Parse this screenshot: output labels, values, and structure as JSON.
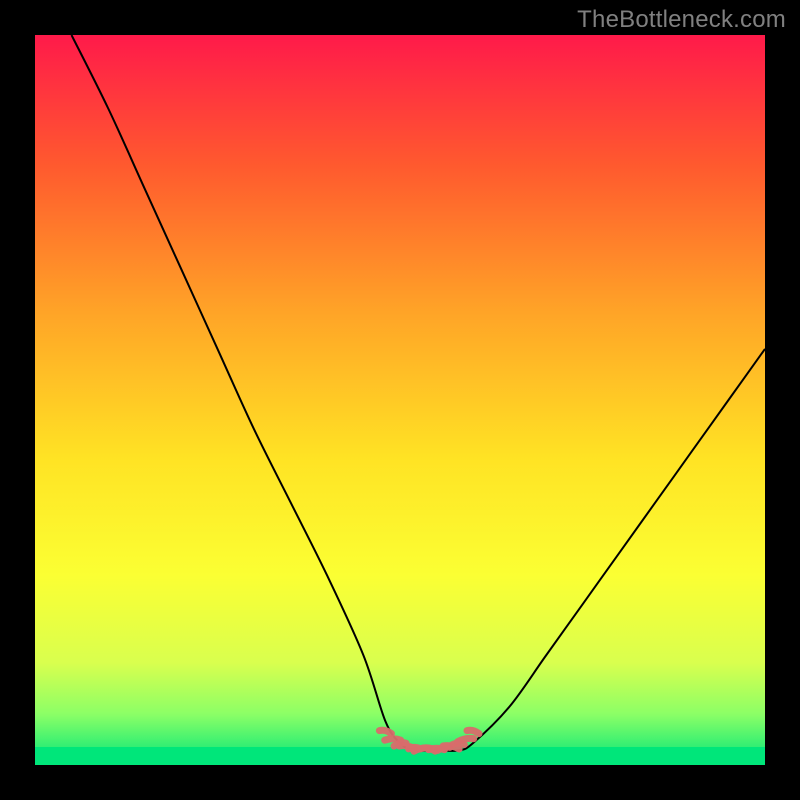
{
  "watermark": "TheBottleneck.com",
  "colors": {
    "frame": "#000000",
    "curve": "#000000",
    "marker": "#d86b6b",
    "gradient": [
      "#ff1a4a",
      "#ff5a2e",
      "#ffa427",
      "#ffe324",
      "#fbff33",
      "#d9ff4e",
      "#8cff66",
      "#00e67a"
    ],
    "bottom_band": "#00e67a"
  },
  "chart_data": {
    "type": "line",
    "title": "",
    "xlabel": "",
    "ylabel": "",
    "xlim": [
      0,
      100
    ],
    "ylim": [
      0,
      100
    ],
    "series": [
      {
        "name": "bottleneck-curve",
        "x": [
          5,
          10,
          15,
          20,
          25,
          30,
          35,
          40,
          45,
          48,
          50,
          52,
          55,
          58,
          60,
          65,
          70,
          75,
          80,
          85,
          90,
          95,
          100
        ],
        "y": [
          100,
          90,
          79,
          68,
          57,
          46,
          36,
          26,
          15,
          6,
          3,
          2,
          2,
          2,
          3,
          8,
          15,
          22,
          29,
          36,
          43,
          50,
          57
        ]
      }
    ],
    "markers": {
      "name": "target-band",
      "x": [
        48,
        49,
        50,
        51,
        52,
        53,
        54,
        55,
        56,
        57,
        58,
        59,
        60
      ],
      "y": [
        4.5,
        3.4,
        2.8,
        2.4,
        2.2,
        2.1,
        2.1,
        2.1,
        2.2,
        2.4,
        2.8,
        3.4,
        4.5
      ]
    }
  }
}
